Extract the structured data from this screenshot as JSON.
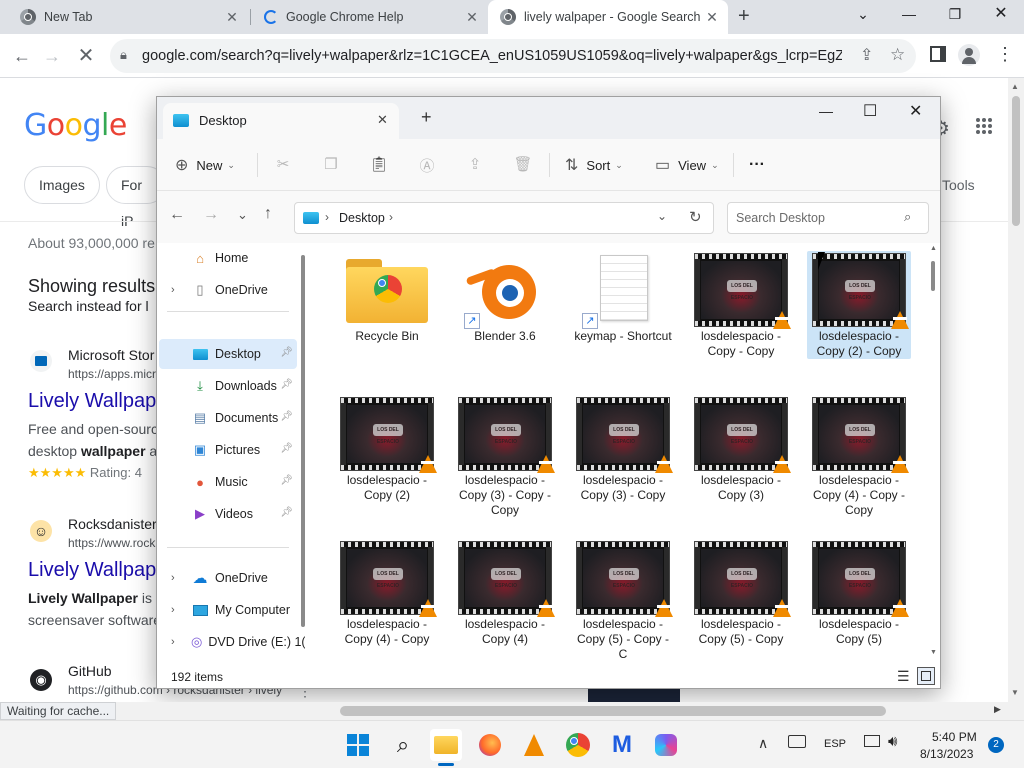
{
  "browser": {
    "tabs": [
      {
        "title": "New Tab",
        "close": "✕"
      },
      {
        "title": "Google Chrome Help",
        "close": "✕"
      },
      {
        "title": "lively walpaper - Google Search",
        "close": "✕",
        "active": true
      }
    ],
    "new_tab": "+",
    "window_controls": {
      "minimize": "—",
      "restore": "❐",
      "close": "✕",
      "tab_search": "⌄"
    },
    "url": "google.com/search?q=lively+walpaper&rlz=1C1GCEA_enUS1059US1059&oq=lively+walpaper&gs_lcrp=EgZjaH...",
    "status_text": "Waiting for cache..."
  },
  "google": {
    "logo": [
      "G",
      "o",
      "o",
      "g",
      "l",
      "e"
    ],
    "logo_colors": [
      "#4285f4",
      "#ea4335",
      "#fbbc05",
      "#4285f4",
      "#34a853",
      "#ea4335"
    ],
    "chips": [
      "Images",
      "For iP"
    ],
    "tools": "Tools",
    "about": "About 93,000,000 re",
    "showing": "Showing results",
    "search_instead": "Search instead for l",
    "results": [
      {
        "site": "Microsoft Stor",
        "url": "https://apps.micr",
        "title": "Lively Wallpap",
        "snippet1": "Free and open-sourc",
        "snippet2_pre": "desktop ",
        "snippet2_bold": "wallpaper",
        "snippet2_post": " a",
        "stars": "★★★★★",
        "rating": "Rating: 4"
      },
      {
        "site": "Rocksdanister",
        "url": "https://www.rock",
        "title": "Lively Wallpap",
        "snippet1_bold": "Lively Wallpaper",
        "snippet1_post": " is",
        "snippet2": "screensaver software"
      },
      {
        "site": "GitHub",
        "url": "https://github.com › rocksdanister › lively"
      }
    ]
  },
  "explorer": {
    "tab_title": "Desktop",
    "tab_close": "✕",
    "new_tab": "+",
    "window_controls": {
      "minimize": "—",
      "maximize": "☐",
      "close": "✕"
    },
    "commands": {
      "new": "New",
      "sort": "Sort",
      "view": "View",
      "more": "···"
    },
    "breadcrumb": "Desktop",
    "search_placeholder": "Search Desktop",
    "nav": {
      "home": "Home",
      "onedrive_top": "OneDrive",
      "quick": [
        "Desktop",
        "Downloads",
        "Documents",
        "Pictures",
        "Music",
        "Videos"
      ],
      "onedrive": "OneDrive",
      "my_computer": "My Computer",
      "dvd": "DVD Drive (E:) 1("
    },
    "files": [
      {
        "name": "Recycle Bin",
        "type": "folder-chrome"
      },
      {
        "name": "Blender 3.6",
        "type": "blender"
      },
      {
        "name": "keymap - Shortcut",
        "type": "doc"
      },
      {
        "name": "losdelespacio - Copy - Copy",
        "type": "video"
      },
      {
        "name": "losdelespacio - Copy (2) - Copy",
        "type": "video",
        "selected": true
      },
      {
        "name": "losdelespacio - Copy (2)",
        "type": "video"
      },
      {
        "name": "losdelespacio - Copy (3) - Copy - Copy",
        "type": "video"
      },
      {
        "name": "losdelespacio - Copy (3) - Copy",
        "type": "video"
      },
      {
        "name": "losdelespacio - Copy (3)",
        "type": "video"
      },
      {
        "name": "losdelespacio - Copy (4) - Copy - Copy",
        "type": "video"
      },
      {
        "name": "losdelespacio - Copy (4) - Copy",
        "type": "video"
      },
      {
        "name": "losdelespacio - Copy (4)",
        "type": "video"
      },
      {
        "name": "losdelespacio - Copy (5) - Copy - C",
        "type": "video"
      },
      {
        "name": "losdelespacio - Copy (5) - Copy",
        "type": "video"
      },
      {
        "name": "losdelespacio - Copy (5)",
        "type": "video"
      }
    ],
    "thumb_logo": "LOS DEL ESPACIO",
    "item_count": "192 items"
  },
  "taskbar": {
    "lang": "ESP",
    "time": "5:40 PM",
    "date": "8/13/2023",
    "notifications": "2"
  }
}
